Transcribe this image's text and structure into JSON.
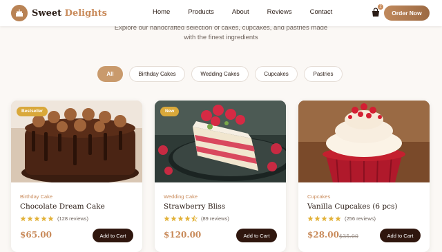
{
  "brand": {
    "name_part1": "Sweet",
    "name_part2": "Delights"
  },
  "nav": {
    "items": [
      "Home",
      "Products",
      "About",
      "Reviews",
      "Contact"
    ],
    "cart_count": "2",
    "order_label": "Order Now"
  },
  "intro": {
    "line1": "Explore our handcrafted selection of cakes, cupcakes, and pastries made",
    "line2": "with the finest ingredients"
  },
  "filters": [
    {
      "label": "All",
      "active": true
    },
    {
      "label": "Birthday Cakes",
      "active": false
    },
    {
      "label": "Wedding Cakes",
      "active": false
    },
    {
      "label": "Cupcakes",
      "active": false
    },
    {
      "label": "Pastries",
      "active": false
    }
  ],
  "products": [
    {
      "tag": "Bestseller",
      "category": "Birthday Cake",
      "title": "Chocolate Dream Cake",
      "rating": 5,
      "reviews": "(128 reviews)",
      "price": "$65.00",
      "old_price": "",
      "button": "Add to Cart",
      "image_icon": "chocolate-cake-image"
    },
    {
      "tag": "New",
      "category": "Wedding Cake",
      "title": "Strawberry Bliss",
      "rating": 4.5,
      "reviews": "(89 reviews)",
      "price": "$120.00",
      "old_price": "",
      "button": "Add to Cart",
      "image_icon": "strawberry-cake-image"
    },
    {
      "tag": "",
      "category": "Cupcakes",
      "title": "Vanilla Cupcakes (6 pcs)",
      "rating": 5,
      "reviews": "(256 reviews)",
      "price": "$28.00",
      "old_price": "$35.00",
      "button": "Add to Cart",
      "image_icon": "cupcake-image"
    }
  ],
  "colors": {
    "accent": "#c98b5b",
    "star": "#e2b23a",
    "dark": "#2f160e"
  }
}
